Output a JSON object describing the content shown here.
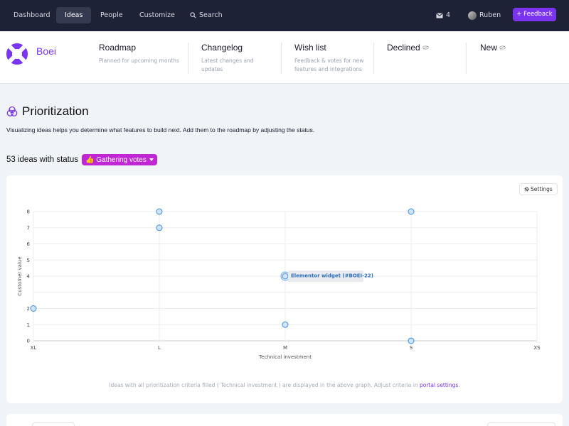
{
  "nav": {
    "dashboard": "Dashboard",
    "ideas": "Ideas",
    "people": "People",
    "customize": "Customize",
    "search": "Search",
    "inbox_count": "4",
    "user": "Ruben",
    "feedback": "+ Feedback"
  },
  "brand": {
    "name": "Boei",
    "accent": "#7a34f0"
  },
  "columns": [
    {
      "title": "Roadmap",
      "subtitle": "Planned for upcoming months"
    },
    {
      "title": "Changelog",
      "subtitle": "Latest changes and updates"
    },
    {
      "title": "Wish list",
      "subtitle": "Feedback & votes for new features and integrations"
    },
    {
      "title": "Declined",
      "subtitle": ""
    },
    {
      "title": "New",
      "subtitle": ""
    }
  ],
  "prioritization": {
    "title": "Prioritization",
    "description": "Visualizing ideas helps you determine what features to build next. Add them to the roadmap by adjusting the status.",
    "count_text": "53 ideas with status",
    "status_label": "👍 Gathering votes",
    "settings_label": "Settings"
  },
  "chart_data": {
    "type": "scatter",
    "xlabel": "Technical investment",
    "ylabel": "Customer value",
    "x_categories": [
      "XL",
      "L",
      "M",
      "S",
      "XS"
    ],
    "y_ticks": [
      0,
      1,
      2,
      4,
      5,
      6,
      7,
      8
    ],
    "ylim": [
      0,
      8
    ],
    "grid": true,
    "points": [
      {
        "x": "XL",
        "y": 2
      },
      {
        "x": "L",
        "y": 8
      },
      {
        "x": "L",
        "y": 7
      },
      {
        "x": "M",
        "y": 4
      },
      {
        "x": "M",
        "y": 1
      },
      {
        "x": "S",
        "y": 8
      },
      {
        "x": "S",
        "y": 0
      }
    ],
    "annotation": {
      "x": "M",
      "y": 4,
      "text": "Elementor widget (#BOEI-22)"
    },
    "point_color": "#3b8de6"
  },
  "footnote": {
    "before": "Ideas with all prioritization criteria filled ( Technical investment ) are displayed in the above graph. Adjust criteria in ",
    "link": "portal settings",
    "after": "."
  }
}
